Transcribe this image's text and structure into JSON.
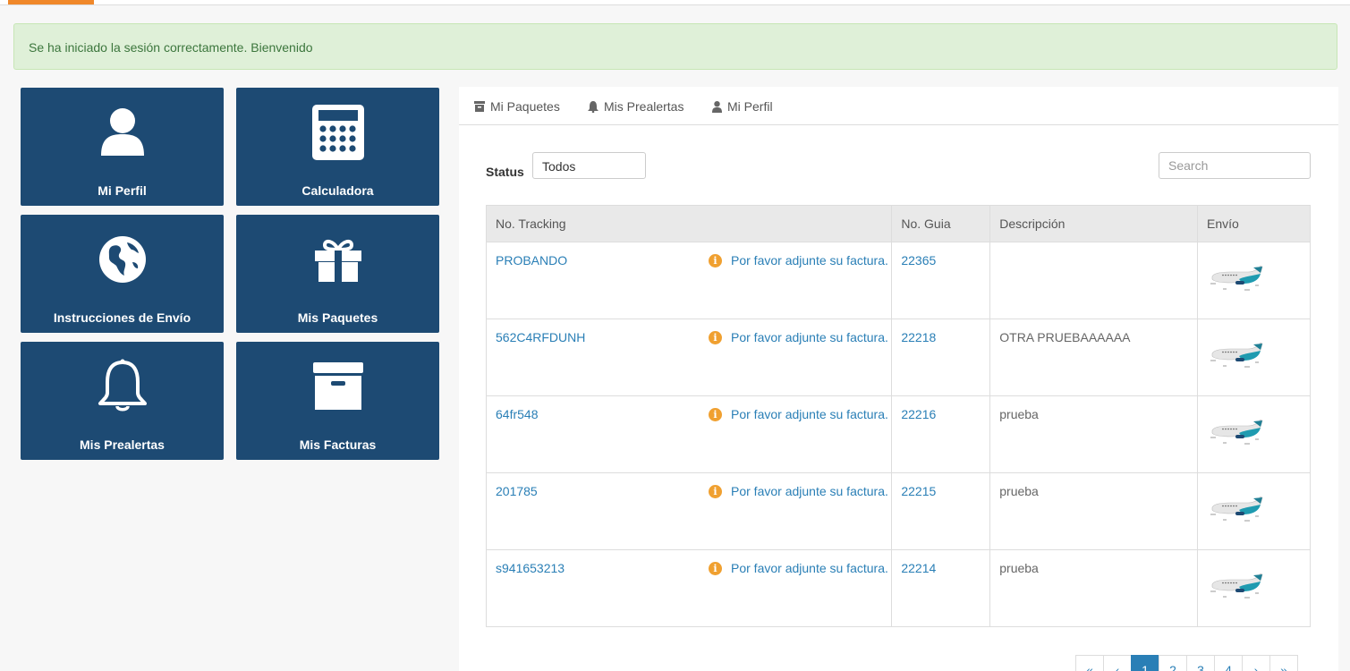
{
  "alert": {
    "message": "Se ha iniciado la sesión correctamente. Bienvenido"
  },
  "tiles": [
    {
      "label": "Mi Perfil",
      "icon": "user-icon"
    },
    {
      "label": "Calculadora",
      "icon": "calculator-icon"
    },
    {
      "label": "Instrucciones de Envío",
      "icon": "globe-icon"
    },
    {
      "label": "Mis Paquetes",
      "icon": "gift-icon"
    },
    {
      "label": "Mis Prealertas",
      "icon": "bell-icon"
    },
    {
      "label": "Mis Facturas",
      "icon": "archive-box-icon"
    }
  ],
  "tabs": [
    {
      "label": "Mi Paquetes",
      "icon": "archive-icon"
    },
    {
      "label": "Mis Prealertas",
      "icon": "bell-icon"
    },
    {
      "label": "Mi Perfil",
      "icon": "user-icon"
    }
  ],
  "filter": {
    "status_label": "Status",
    "status_value": "Todos",
    "search_placeholder": "Search"
  },
  "table": {
    "headers": [
      "No. Tracking",
      "No. Guia",
      "Descripción",
      "Envío"
    ],
    "warning_text": "Por favor adjunte su factura.",
    "rows": [
      {
        "tracking": "PROBANDO",
        "guia": "22365",
        "descripcion": ""
      },
      {
        "tracking": "562C4RFDUNH",
        "guia": "22218",
        "descripcion": "OTRA PRUEBAAAAAA"
      },
      {
        "tracking": "64fr548",
        "guia": "22216",
        "descripcion": "prueba"
      },
      {
        "tracking": "201785",
        "guia": "22215",
        "descripcion": "prueba"
      },
      {
        "tracking": "s941653213",
        "guia": "22214",
        "descripcion": "prueba"
      }
    ]
  },
  "pagination": {
    "first": "«",
    "prev": "‹",
    "pages": [
      "1",
      "2",
      "3",
      "4"
    ],
    "active": "1",
    "next": "›",
    "last": "»"
  },
  "colors": {
    "tile_bg": "#1d4a73",
    "link": "#2a7fb6",
    "warning": "#f0a030",
    "accent": "#f0882a",
    "alert_bg": "#dff0d8"
  }
}
